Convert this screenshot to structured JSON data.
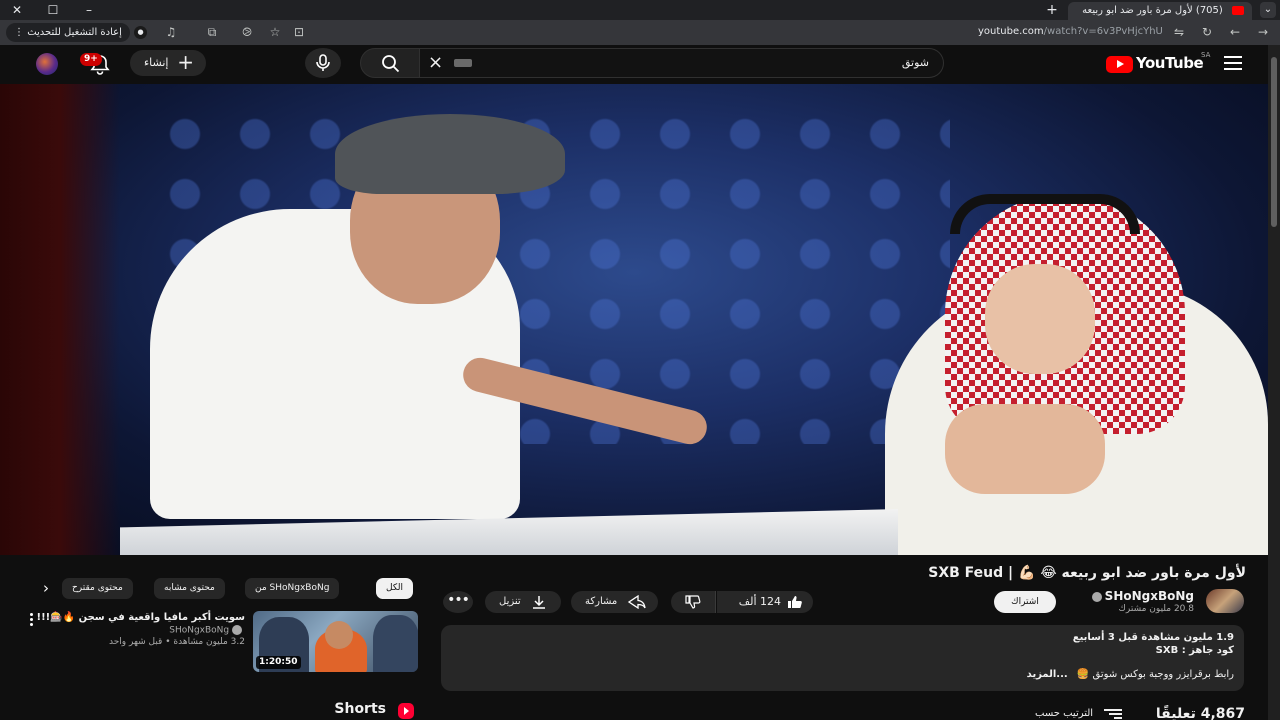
{
  "browser": {
    "tab_title": "(705) لأول مرة باور ضد ابو ربيعه",
    "url_host": "youtube.com",
    "url_path": "/watch?v=6v3PvHjcYhU",
    "reload_label": "إعادة التشغيل للتحديث",
    "new_tab_symbol": "+",
    "window_close_symbol": "✕",
    "window_max_symbol": "☐",
    "window_min_symbol": "–"
  },
  "header": {
    "logo_text": "YouTube",
    "country_code": "SA",
    "search_query": "شوتق",
    "create_label": "إنشاء",
    "notifications_badge": "9+"
  },
  "video": {
    "title": "لأول مرة باور ضد ابو ربيعه 😂 💪🏻 | SXB Feud",
    "channel_name": "SHoNgxBoNg",
    "subscribers": "20.8 مليون مشترك",
    "subscribe_label": "اشتراك",
    "like_count": "124 ألف",
    "share_label": "مشاركة",
    "download_label": "تنزيل",
    "more_symbol": "•••"
  },
  "description": {
    "stats": "1.9 مليون مشاهدة  قبل 3 أسابيع",
    "line2": "كود جاهز : SXB",
    "line3": "رابط برقرايزر ووجبة بوكس شوتق 🍔",
    "more_label": "...المزيد"
  },
  "comments": {
    "count_label": "4,867 تعليقًا",
    "sort_label": "الترتيب حسب"
  },
  "chips": [
    {
      "label": "الكل",
      "active": true
    },
    {
      "label": "من SHoNgxBoNg",
      "active": false
    },
    {
      "label": "محتوى مشابه",
      "active": false
    },
    {
      "label": "محتوى مقترح",
      "active": false
    }
  ],
  "chip_next_symbol": "›",
  "related": [
    {
      "title": "سويت أكبر مافيا واقعية في سجن 🔥🎰!!!",
      "channel": "SHoNgxBoNg",
      "meta": "3.2 مليون مشاهدة • قبل شهر واحد",
      "duration": "1:20:50"
    }
  ],
  "shorts": {
    "title": "Shorts"
  },
  "colors": {
    "background": "#0f0f0f",
    "surface": "#272727",
    "brand_red": "#ff0000"
  }
}
